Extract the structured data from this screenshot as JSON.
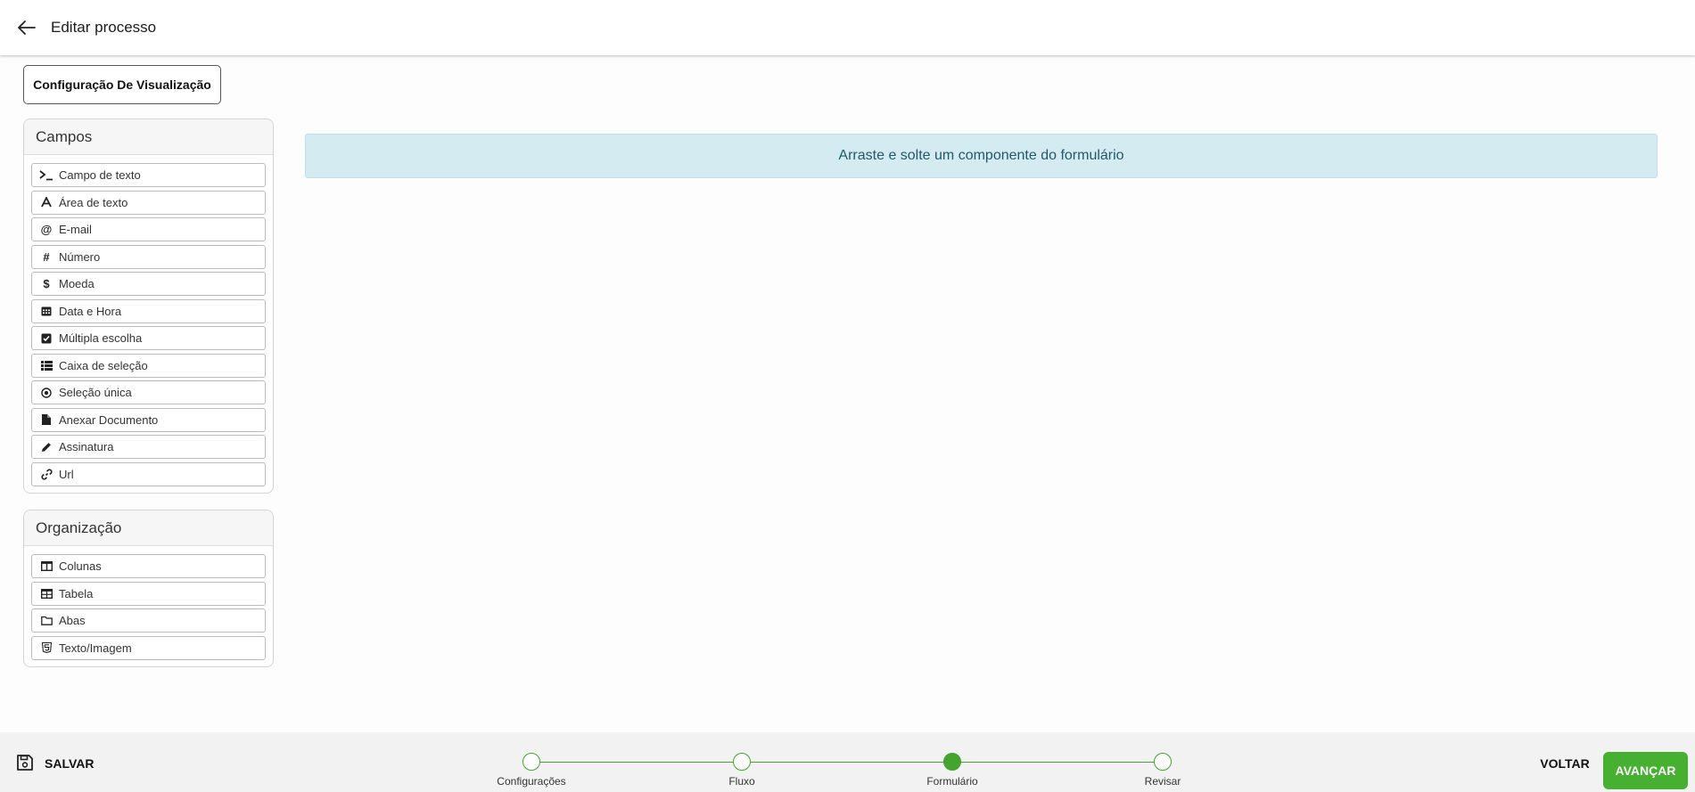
{
  "header": {
    "title": "Editar processo"
  },
  "config_button": {
    "label": "Configuração De Visualização"
  },
  "fields_panel": {
    "title": "Campos",
    "items": [
      {
        "label": "Campo de texto",
        "icon": "terminal-icon"
      },
      {
        "label": "Área de texto",
        "icon": "font-a-icon"
      },
      {
        "label": "E-mail",
        "icon": "at-icon"
      },
      {
        "label": "Número",
        "icon": "hash-icon"
      },
      {
        "label": "Moeda",
        "icon": "dollar-icon"
      },
      {
        "label": "Data e Hora",
        "icon": "calendar-icon"
      },
      {
        "label": "Múltipla escolha",
        "icon": "checkbox-icon"
      },
      {
        "label": "Caixa de seleção",
        "icon": "list-icon"
      },
      {
        "label": "Seleção única",
        "icon": "radio-icon"
      },
      {
        "label": "Anexar Documento",
        "icon": "file-icon"
      },
      {
        "label": "Assinatura",
        "icon": "pencil-icon"
      },
      {
        "label": "Url",
        "icon": "link-icon"
      }
    ]
  },
  "organization_panel": {
    "title": "Organização",
    "items": [
      {
        "label": "Colunas",
        "icon": "columns-icon"
      },
      {
        "label": "Tabela",
        "icon": "table-icon"
      },
      {
        "label": "Abas",
        "icon": "folder-icon"
      },
      {
        "label": "Texto/Imagem",
        "icon": "html5-icon"
      }
    ]
  },
  "drop_zone": {
    "text": "Arraste e solte um componente do formulário"
  },
  "footer": {
    "save_label": "SALVAR",
    "back_label": "VOLTAR",
    "next_label": "AVANÇAR",
    "steps": [
      {
        "label": "Configurações",
        "state": "completed"
      },
      {
        "label": "Fluxo",
        "state": "completed"
      },
      {
        "label": "Formulário",
        "state": "active"
      },
      {
        "label": "Revisar",
        "state": "pending"
      }
    ]
  },
  "colors": {
    "accent_green": "#46b030",
    "drop_zone_bg": "#d4ebf2",
    "drop_zone_text": "#1f5a6b"
  }
}
